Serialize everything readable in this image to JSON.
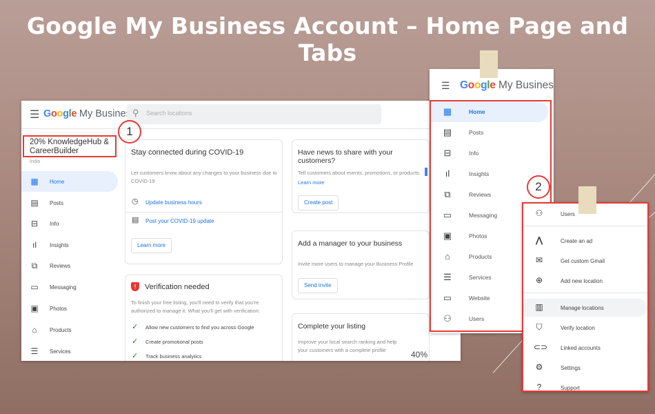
{
  "slide": {
    "title": "Google My Business Account – Home Page and Tabs"
  },
  "main": {
    "logo_google": "Google",
    "logo_rest": "My Business",
    "search_placeholder": "Search locations",
    "account": {
      "name": "20% KnowledgeHub & CareerBuilder",
      "country": "India"
    },
    "marker": "1",
    "nav": [
      {
        "label": "Home",
        "icon": "home-dashboard-icon",
        "active": true
      },
      {
        "label": "Posts",
        "icon": "posts-icon"
      },
      {
        "label": "Info",
        "icon": "store-icon"
      },
      {
        "label": "Insights",
        "icon": "bar-chart-icon"
      },
      {
        "label": "Reviews",
        "icon": "reviews-icon"
      },
      {
        "label": "Messaging",
        "icon": "chat-icon"
      },
      {
        "label": "Photos",
        "icon": "photo-icon"
      },
      {
        "label": "Products",
        "icon": "basket-icon"
      },
      {
        "label": "Services",
        "icon": "list-icon"
      }
    ],
    "covid": {
      "title": "Stay connected during COVID-19",
      "text": "Let customers know about any changes to your business due to COVID-19",
      "link1": "Update business hours",
      "link2": "Post your COVID-19 update",
      "button": "Learn more"
    },
    "verify": {
      "title": "Verification needed",
      "text": "To finish your free listing, you'll need to verify that you're authorized to manage it. What you'll get with verification:",
      "items": [
        "Allow new customers to find you across Google",
        "Create promotional posts",
        "Track business analytics"
      ]
    },
    "news": {
      "title": "Have news to share with your customers?",
      "text": "Tell customers about events, promotions, or products.",
      "link": "Learn more",
      "button": "Create post"
    },
    "manager": {
      "title": "Add a manager to your business",
      "text": "Invite more users to manage your Business Profile",
      "button": "Send invite"
    },
    "complete": {
      "title": "Complete your listing",
      "text": "Improve your local search ranking and help your customers with a complete profile",
      "percent": "40%"
    }
  },
  "panelA": {
    "logo_google": "Google",
    "logo_rest": "My Business",
    "items": [
      {
        "label": "Home",
        "icon": "home-dashboard-icon",
        "active": true
      },
      {
        "label": "Posts",
        "icon": "posts-icon"
      },
      {
        "label": "Info",
        "icon": "store-icon"
      },
      {
        "label": "Insights",
        "icon": "bar-chart-icon"
      },
      {
        "label": "Reviews",
        "icon": "reviews-icon"
      },
      {
        "label": "Messaging",
        "icon": "chat-icon"
      },
      {
        "label": "Photos",
        "icon": "photo-icon"
      },
      {
        "label": "Products",
        "icon": "basket-icon"
      },
      {
        "label": "Services",
        "icon": "list-icon"
      },
      {
        "label": "Website",
        "icon": "website-icon"
      },
      {
        "label": "Users",
        "icon": "add-user-icon"
      }
    ]
  },
  "panelB": {
    "marker": "2",
    "items": [
      {
        "label": "Users",
        "icon": "add-user-icon"
      },
      {
        "label": "Create an ad",
        "icon": "google-ads-icon"
      },
      {
        "label": "Get custom Gmail",
        "icon": "gmail-icon"
      },
      {
        "label": "Add new location",
        "icon": "add-location-icon"
      },
      {
        "label": "Manage locations",
        "icon": "manage-locations-icon",
        "highlight": true
      },
      {
        "label": "Verify location",
        "icon": "verify-shield-icon"
      },
      {
        "label": "Linked accounts",
        "icon": "link-icon"
      },
      {
        "label": "Settings",
        "icon": "settings-gear-icon"
      },
      {
        "label": "Support",
        "icon": "help-icon"
      }
    ]
  },
  "colors": {
    "accent": "#1a73e8",
    "marker_red": "#e53935",
    "google_blue": "#4285f4",
    "google_red": "#ea4335",
    "google_yellow": "#fbbc05",
    "google_green": "#34a853"
  }
}
